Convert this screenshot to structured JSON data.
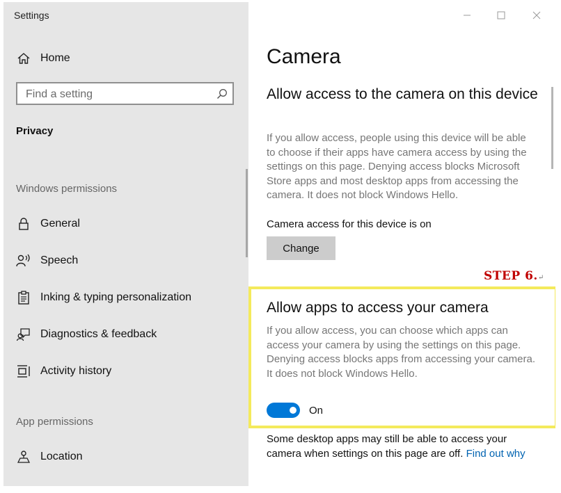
{
  "window": {
    "title": "Settings"
  },
  "sidebar": {
    "home_label": "Home",
    "search_placeholder": "Find a setting",
    "category": "Privacy",
    "windows_permissions_header": "Windows permissions",
    "windows_items": [
      {
        "label": "General",
        "icon": "lock-icon"
      },
      {
        "label": "Speech",
        "icon": "speech-icon"
      },
      {
        "label": "Inking & typing personalization",
        "icon": "inking-icon"
      },
      {
        "label": "Diagnostics & feedback",
        "icon": "feedback-icon"
      },
      {
        "label": "Activity history",
        "icon": "activity-history-icon"
      }
    ],
    "app_permissions_header": "App permissions",
    "app_items": [
      {
        "label": "Location",
        "icon": "location-icon"
      }
    ]
  },
  "main": {
    "page_title": "Camera",
    "device_section": {
      "heading": "Allow access to the camera on this device",
      "description": "If you allow access, people using this device will be able to choose if their apps have camera access by using the settings on this page. Denying access blocks Microsoft Store apps and most desktop apps from accessing the camera. It does not block Windows Hello.",
      "status": "Camera access for this device is on",
      "change_button": "Change"
    },
    "apps_section": {
      "heading": "Allow apps to access your camera",
      "description": "If you allow access, you can choose which apps can access your camera by using the settings on this page. Denying access blocks apps from accessing your camera. It does not block Windows Hello.",
      "toggle_state": "On",
      "toggle_on": true,
      "note": "Some desktop apps may still be able to access your camera when settings on this page are off.",
      "link": "Find out why"
    }
  },
  "annotation": {
    "step_label": "STEP 6.",
    "step_mark": "↵",
    "color": "#c00000",
    "box_color": "#f4ea5c"
  },
  "colors": {
    "accent": "#0078d7",
    "link": "#0063b1",
    "sidebar_bg": "#e6e6e6"
  }
}
